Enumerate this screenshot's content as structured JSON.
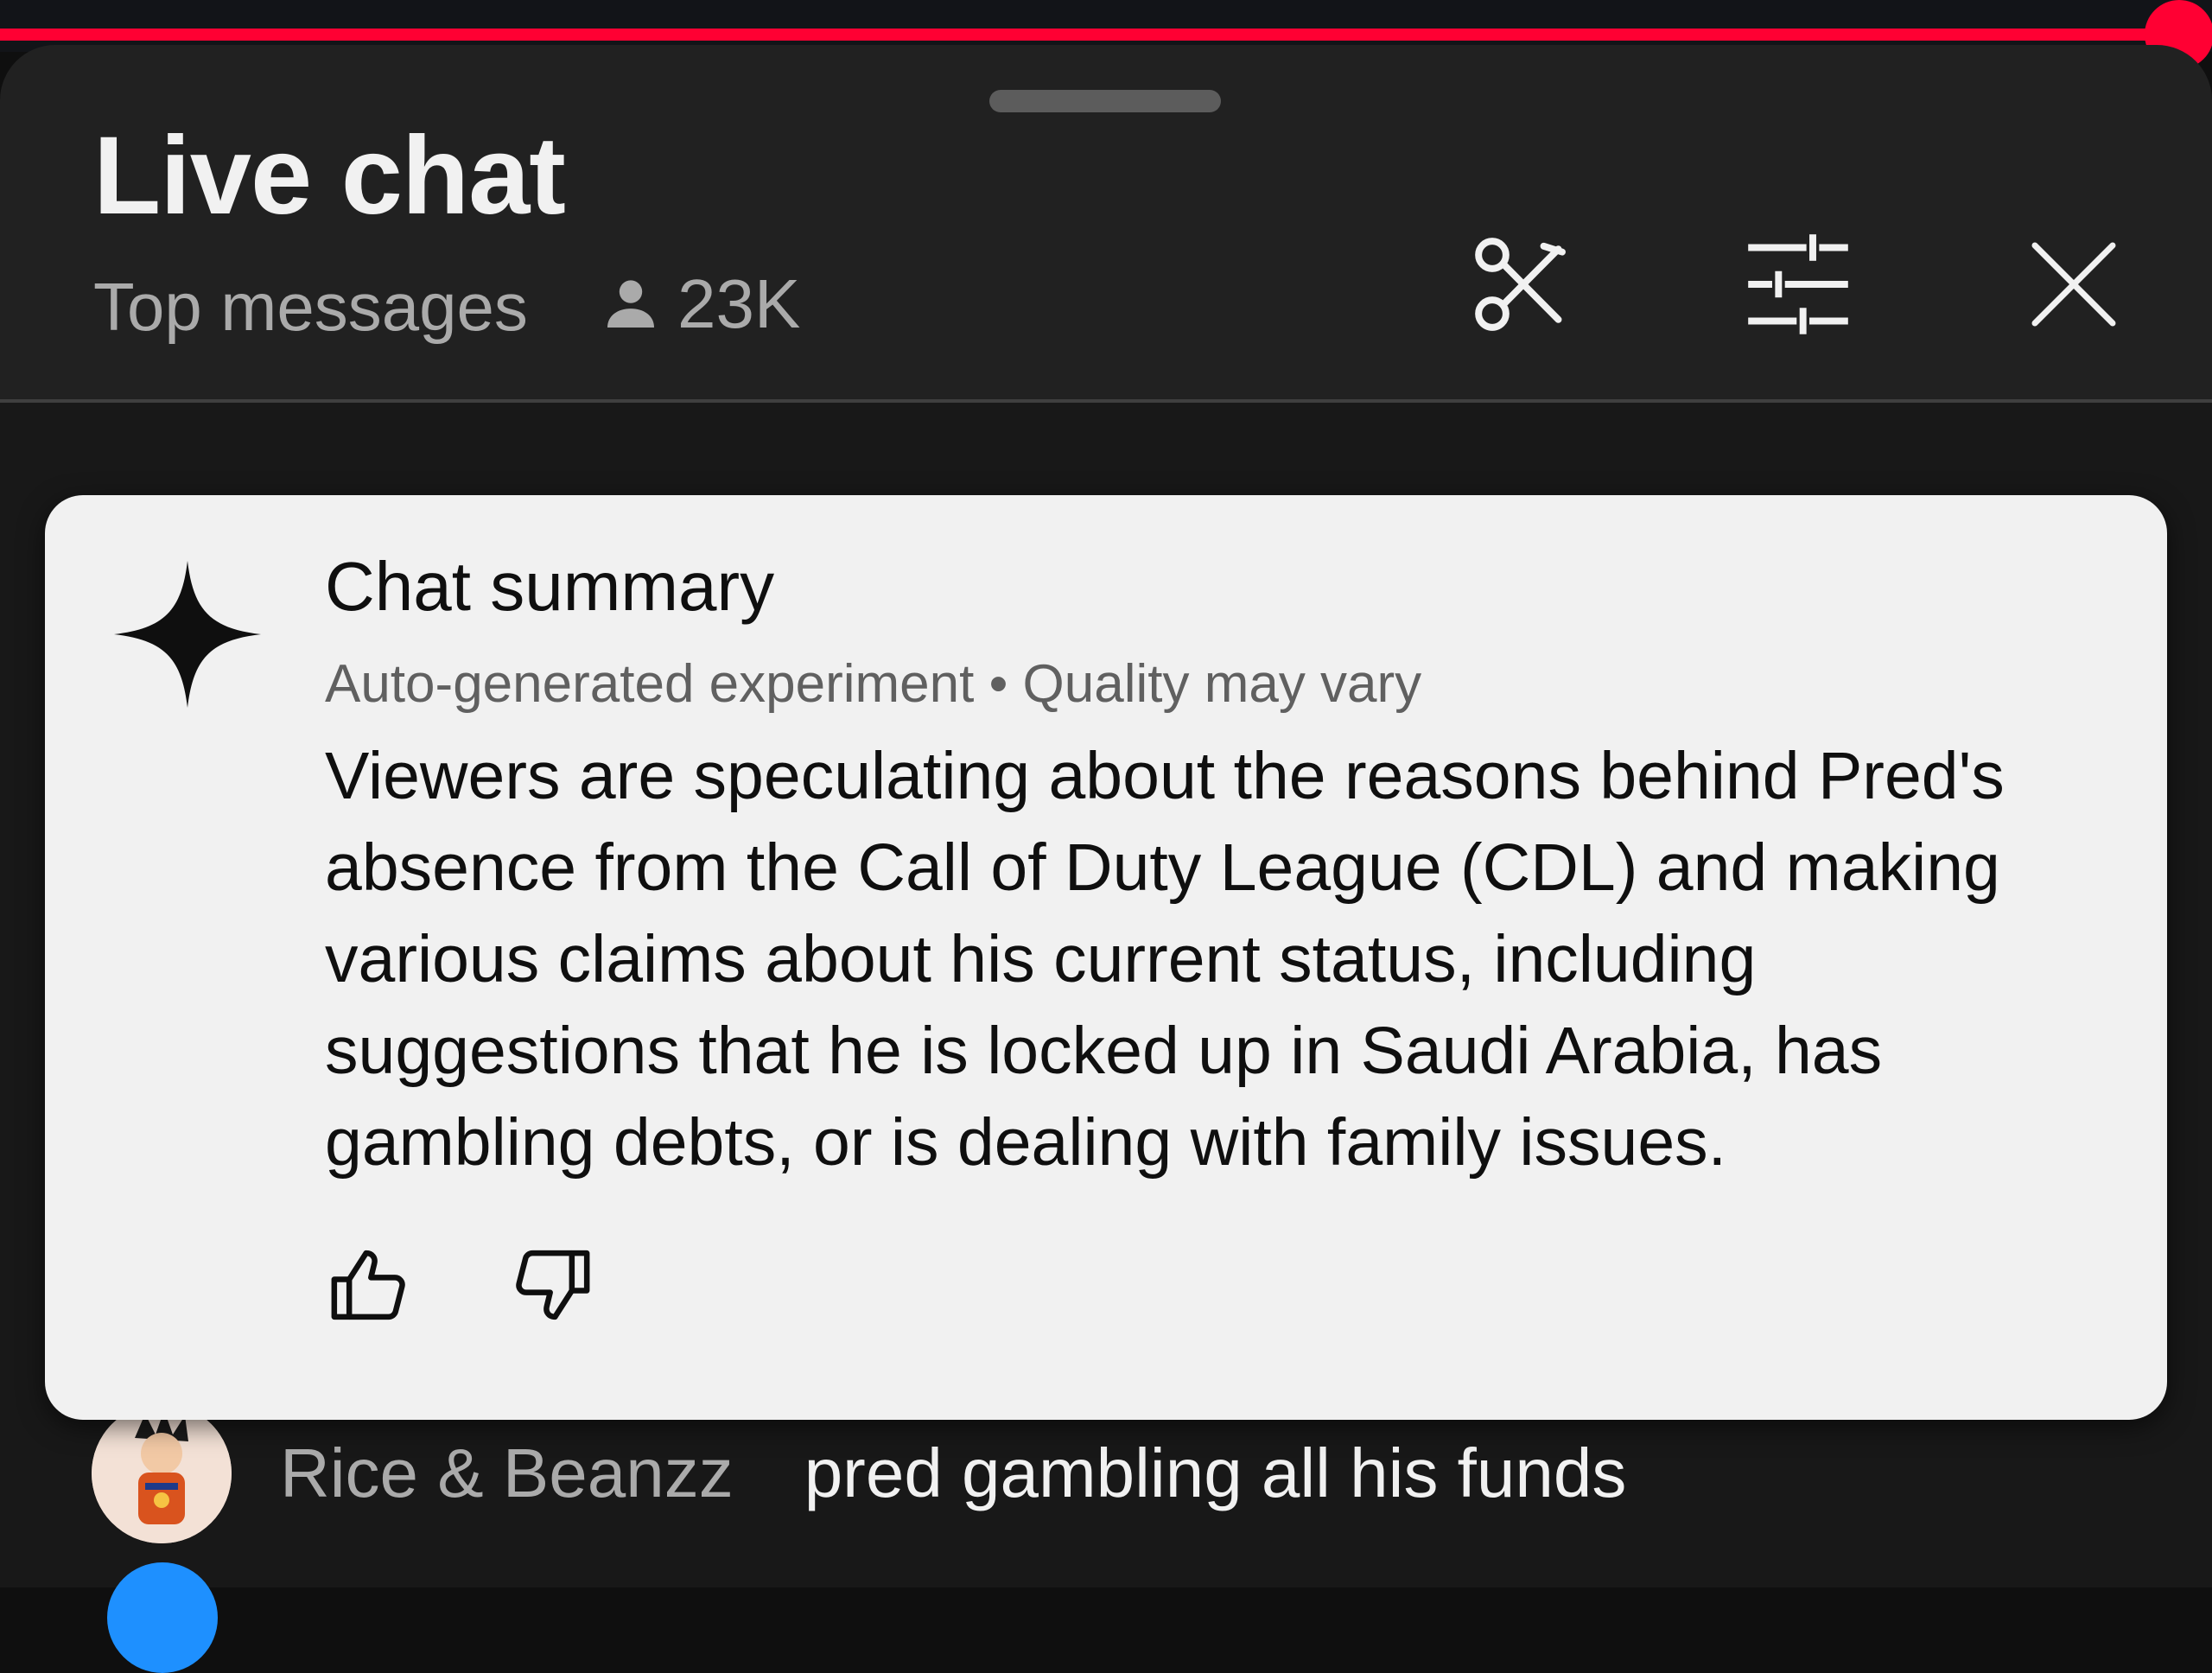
{
  "player": {
    "progress_percent": 98.5
  },
  "header": {
    "title": "Live chat",
    "mode_label": "Top messages",
    "viewer_count": "23K",
    "icons": [
      "scissors-icon",
      "filter-sliders-icon",
      "close-icon"
    ]
  },
  "summary": {
    "title": "Chat summary",
    "meta": "Auto-generated experiment • Quality may vary",
    "body": "Viewers are speculating about the reasons behind Pred's absence from the Call of Duty League (CDL) and making various claims about his current status, including suggestions that he is locked up in Saudi Arabia, has gambling debts, or is dealing with family issues.",
    "icons": [
      "sparkle-icon",
      "thumbs-up-icon",
      "thumbs-down-icon"
    ]
  },
  "chat": {
    "messages": [
      {
        "author": "Rice & Beanzz",
        "text": "pred gambling all his funds"
      }
    ]
  },
  "colors": {
    "accent_red": "#ff0033",
    "sheet_bg": "#212121",
    "card_bg": "#f1f1f1"
  }
}
